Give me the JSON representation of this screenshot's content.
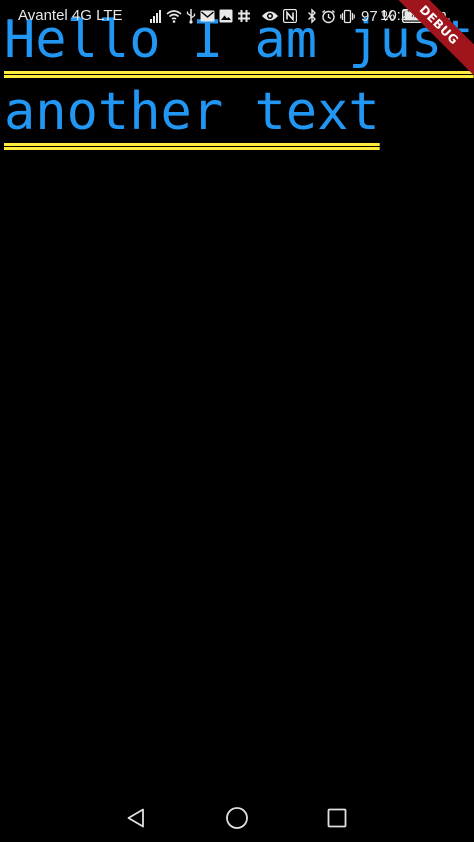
{
  "status_bar": {
    "carrier": "Avantel 4G LTE",
    "battery_percent": "97 %",
    "time": "10:21 p.m.",
    "icons": [
      "signal-icon",
      "wifi-icon",
      "usb-icon",
      "gmail-icon",
      "image-icon",
      "slack-icon",
      "eye-icon",
      "nfc-icon",
      "bluetooth-icon",
      "alarm-icon",
      "vibrate-icon",
      "battery-icon"
    ]
  },
  "debug_banner": {
    "label": "DEBUG",
    "color": "#a0151c"
  },
  "content": {
    "text": "Hello I am just another text",
    "text_color": "#2196f3",
    "underline_color": "#ffeb3b",
    "underline_style": "double"
  },
  "nav_bar": {
    "buttons": [
      "back-icon",
      "home-icon",
      "recents-icon"
    ]
  }
}
